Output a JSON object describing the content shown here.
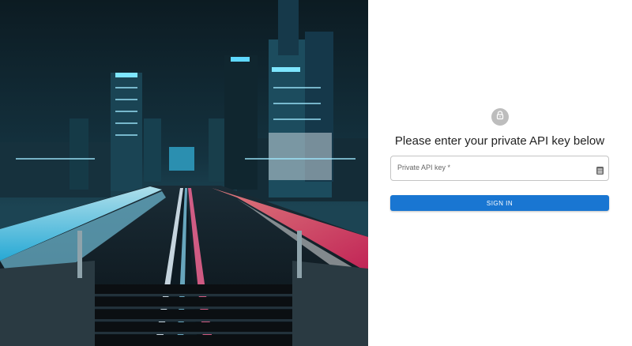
{
  "login": {
    "heading": "Please enter your private API key below",
    "api_key_label": "Private API key *",
    "api_key_value": "",
    "sign_in_label": "SIGN IN"
  },
  "icons": {
    "avatar": "lock-icon",
    "field_adornment": "password-manager-icon"
  },
  "colors": {
    "primary": "#1976d2",
    "avatar_bg": "#bdbdbd",
    "field_border": "#c4c4c4"
  }
}
